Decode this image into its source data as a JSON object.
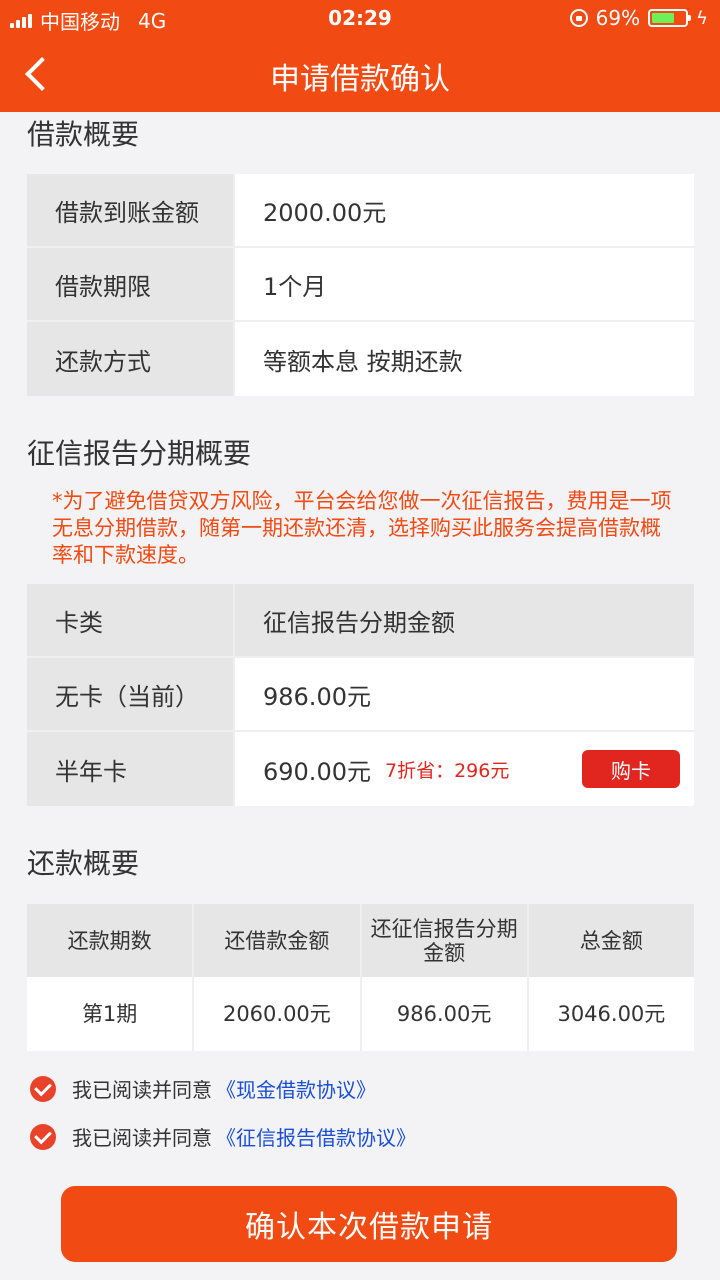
{
  "status": {
    "carrier": "中国移动",
    "network": "4G",
    "time": "02:29",
    "battery": "69%",
    "battery_level": 0.69
  },
  "nav": {
    "title": "申请借款确认"
  },
  "loan_summary": {
    "title": "借款概要",
    "rows": [
      {
        "label": "借款到账金额",
        "value": "2000.00元"
      },
      {
        "label": "借款期限",
        "value": "1个月"
      },
      {
        "label": "还款方式",
        "value": "等额本息 按期还款"
      }
    ]
  },
  "credit_summary": {
    "title": "征信报告分期概要",
    "notice": "*为了避免借贷双方风险，平台会给您做一次征信报告，费用是一项无息分期借款，随第一期还款还清，选择购买此服务会提高借款概率和下款速度。",
    "header": {
      "label": "卡类",
      "value": "征信报告分期金额"
    },
    "rows": [
      {
        "label": "无卡（当前）",
        "value": "986.00元"
      },
      {
        "label": "半年卡",
        "value": "690.00元",
        "discount": "7折省：296元",
        "button": "购卡"
      }
    ]
  },
  "repay_summary": {
    "title": "还款概要",
    "columns": [
      "还款期数",
      "还借款金额",
      "还征信报告分期金额",
      "总金额"
    ],
    "rows": [
      [
        "第1期",
        "2060.00元",
        "986.00元",
        "3046.00元"
      ]
    ]
  },
  "agreements": [
    {
      "text": "我已阅读并同意",
      "link": "《现金借款协议》"
    },
    {
      "text": "我已阅读并同意",
      "link": "《征信报告借款协议》"
    }
  ],
  "confirm_button": "确认本次借款申请",
  "colors": {
    "brand": "#f24a13",
    "accent_red": "#e0261f",
    "link": "#1a4fd6"
  }
}
